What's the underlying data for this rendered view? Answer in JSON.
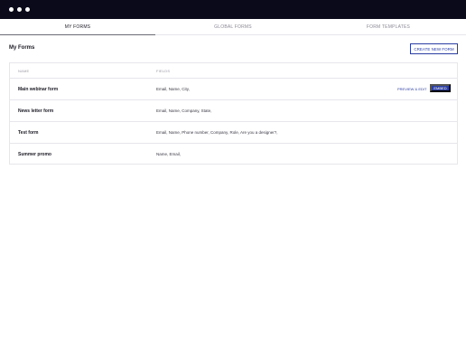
{
  "window": {
    "controls": [
      "dot",
      "dot",
      "dot"
    ]
  },
  "tabs": [
    {
      "label": "MY FORMS",
      "active": true
    },
    {
      "label": "GLOBAL FORMS",
      "active": false
    },
    {
      "label": "FORM TEMPLATES",
      "active": false
    }
  ],
  "page": {
    "title": "My Forms",
    "create_button": "CREATE NEW FORM"
  },
  "table": {
    "columns": {
      "name": "NAME",
      "fields": "FIELDS"
    },
    "rows": [
      {
        "name": "Main webinar form",
        "fields": "Email, Name, City,",
        "preview_label": "PREVIEW & EDIT",
        "embed_label": "EMBED"
      },
      {
        "name": "News letter form",
        "fields": "Email, Name, Company, State,"
      },
      {
        "name": "Test form",
        "fields": "Email, Name, Phone number, Company, Role, Are you a designer?,"
      },
      {
        "name": "Summer promo",
        "fields": "Name, Email,"
      }
    ]
  },
  "colors": {
    "accent": "#2b3ea3",
    "titlebar": "#0a0a1a",
    "border": "#e6e6ec"
  }
}
